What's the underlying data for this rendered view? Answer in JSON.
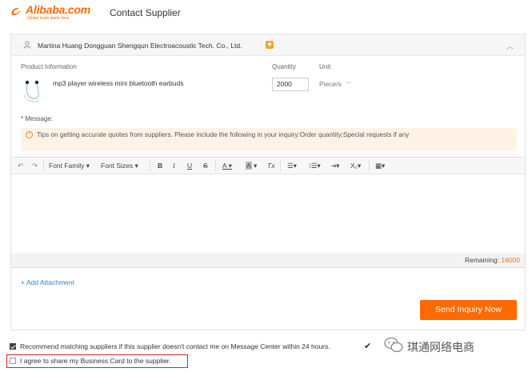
{
  "header": {
    "logo_text": "Alibaba.com",
    "logo_tagline": "Global trade starts here",
    "title": "Contact Supplier"
  },
  "supplier": {
    "name": "Martina Huang Dongguan Shengqun Electroacoustic Tech. Co., Ltd."
  },
  "product": {
    "info_label": "Product Information",
    "quantity_label": "Quantity",
    "unit_label": "Unit",
    "name": "mp3 player wireless mini bluetooth earbuds",
    "quantity": "2000",
    "unit": "Piece/s"
  },
  "message": {
    "label": "* Message:",
    "tips": "Tips on getting accurate quotes from suppliers. Please include the following in your inquiry:Order quantity;Special requests if any"
  },
  "toolbar": {
    "font_family": "Font Family",
    "font_sizes": "Font Sizes",
    "bold": "B",
    "italic": "I",
    "underline": "U",
    "strike": "S",
    "text_color": "A",
    "bg_color": "A",
    "clear_format": "Tx",
    "subscript": "X"
  },
  "editor": {
    "remaining_label": "Remaining:",
    "remaining_count": "16000"
  },
  "actions": {
    "add_attachment": "+ Add Attachment",
    "send": "Send Inquiry Now"
  },
  "options": {
    "recommend_text": "Recommend matching suppliers if this supplier doesn't contact me on Message Center within 24 hours.",
    "recommend_checked": true,
    "share_text": "I agree to share my Business Card to the supplier.",
    "share_checked": false
  },
  "watermark": {
    "text": "琪通网络电商"
  },
  "colors": {
    "brand": "#ff6a00",
    "link": "#3d7cc9",
    "highlight_border": "#d7261f"
  }
}
